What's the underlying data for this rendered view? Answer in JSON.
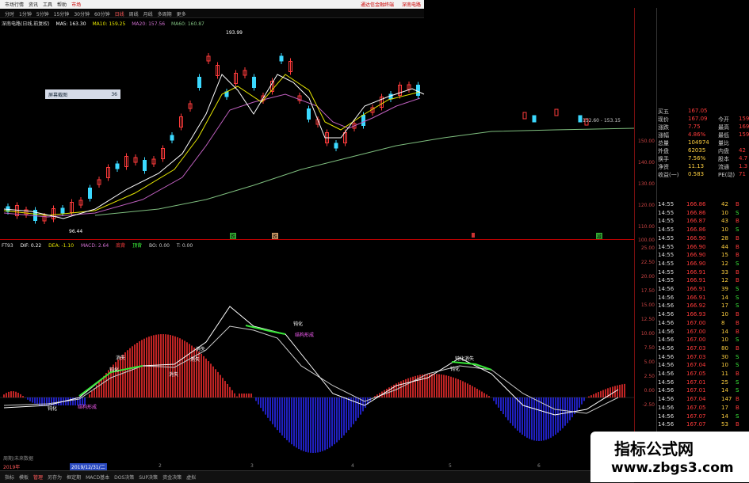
{
  "menubar": {
    "items": [
      "市场行情",
      "资讯",
      "工具",
      "帮助",
      "市场"
    ],
    "right_items": [
      "通达信金融终端",
      "深南电路"
    ]
  },
  "timebar": {
    "items": [
      "分时",
      "1分钟",
      "5分钟",
      "15分钟",
      "30分钟",
      "60分钟",
      "日线",
      "周线",
      "月线",
      "多周期",
      "更多"
    ]
  },
  "title": {
    "stock": "深南电路(日线,前复权)",
    "ma5": "MA5: 163.30",
    "ma10": "MA10: 159.25",
    "ma20": "MA20: 157.56",
    "ma60": "MA60: 160.87"
  },
  "price_chart": {
    "max_label": "193.99",
    "min_label": "96.44",
    "range_label": "152.60 - 153.15",
    "popup": {
      "label": "屏幕截图",
      "value": "36"
    },
    "markers": [
      "跌",
      "跌",
      "跌",
      "减"
    ]
  },
  "indicator": {
    "name": "FT93",
    "dif": "DIF: 0.22",
    "dea": "DEA: -1.10",
    "macd": "MACD: 2.64",
    "t1": "底背",
    "t2": "顶背",
    "bo": "BO: 0.00",
    "t": "T: 0.00",
    "annotations": [
      "消失",
      "钝化",
      "消失",
      "消失",
      "钝化",
      "钝化",
      "结构形成",
      "钝化",
      "钝化消失",
      "消失",
      "结构形成"
    ]
  },
  "yaxis_price": [
    "150.00",
    "140.00",
    "130.00",
    "120.00",
    "110.00",
    "100.00"
  ],
  "yaxis_ind": [
    "25.00",
    "22.50",
    "20.00",
    "17.50",
    "15.00",
    "12.50",
    "10.00",
    "7.50",
    "5.00",
    "2.50",
    "0.00",
    "-2.50"
  ],
  "quote": [
    {
      "label": "买五",
      "value": "167.05",
      "label2": "",
      "value2": ""
    },
    {
      "label": "现价",
      "value": "167.09",
      "label2": "今开",
      "value2": "159"
    },
    {
      "label": "涨跌",
      "value": "7.75",
      "label2": "最高",
      "value2": "169"
    },
    {
      "label": "涨幅",
      "value": "4.86%",
      "label2": "最低",
      "value2": "159"
    },
    {
      "label": "总量",
      "value": "104974",
      "label2": "量比",
      "value2": ""
    },
    {
      "label": "外盘",
      "value": "62035",
      "label2": "内盘",
      "value2": "42"
    },
    {
      "label": "换手",
      "value": "7.56%",
      "label2": "股本",
      "value2": "4.7"
    },
    {
      "label": "净资",
      "value": "11.13",
      "label2": "流通",
      "value2": "1.3"
    },
    {
      "label": "收益(一)",
      "value": "0.583",
      "label2": "PE(动)",
      "value2": "71"
    }
  ],
  "ticks": [
    {
      "t": "14:55",
      "p": "166.86",
      "v": "42",
      "s": "B"
    },
    {
      "t": "14:55",
      "p": "166.86",
      "v": "10",
      "s": "S"
    },
    {
      "t": "14:55",
      "p": "166.87",
      "v": "43",
      "s": "B"
    },
    {
      "t": "14:55",
      "p": "166.86",
      "v": "10",
      "s": "S"
    },
    {
      "t": "14:55",
      "p": "166.90",
      "v": "28",
      "s": "B"
    },
    {
      "t": "14:55",
      "p": "166.90",
      "v": "44",
      "s": "B"
    },
    {
      "t": "14:55",
      "p": "166.90",
      "v": "15",
      "s": "B"
    },
    {
      "t": "14:55",
      "p": "166.90",
      "v": "12",
      "s": "S"
    },
    {
      "t": "14:55",
      "p": "166.91",
      "v": "33",
      "s": "B"
    },
    {
      "t": "14:55",
      "p": "166.91",
      "v": "12",
      "s": "B"
    },
    {
      "t": "14:56",
      "p": "166.91",
      "v": "39",
      "s": "S"
    },
    {
      "t": "14:56",
      "p": "166.91",
      "v": "14",
      "s": "S"
    },
    {
      "t": "14:56",
      "p": "166.92",
      "v": "17",
      "s": "S"
    },
    {
      "t": "14:56",
      "p": "166.93",
      "v": "10",
      "s": "B"
    },
    {
      "t": "14:56",
      "p": "167.00",
      "v": "8",
      "s": "B"
    },
    {
      "t": "14:56",
      "p": "167.00",
      "v": "14",
      "s": "B"
    },
    {
      "t": "14:56",
      "p": "167.00",
      "v": "10",
      "s": "S"
    },
    {
      "t": "14:56",
      "p": "167.03",
      "v": "80",
      "s": "B"
    },
    {
      "t": "14:56",
      "p": "167.03",
      "v": "30",
      "s": "S"
    },
    {
      "t": "14:56",
      "p": "167.04",
      "v": "10",
      "s": "S"
    },
    {
      "t": "14:56",
      "p": "167.05",
      "v": "11",
      "s": "B"
    },
    {
      "t": "14:56",
      "p": "167.01",
      "v": "25",
      "s": "S"
    },
    {
      "t": "14:56",
      "p": "167.01",
      "v": "14",
      "s": "S"
    },
    {
      "t": "14:56",
      "p": "167.04",
      "v": "147",
      "s": "B"
    },
    {
      "t": "14:56",
      "p": "167.05",
      "v": "17",
      "s": "B"
    },
    {
      "t": "14:56",
      "p": "167.07",
      "v": "14",
      "s": "S"
    },
    {
      "t": "14:56",
      "p": "167.07",
      "v": "53",
      "s": "B"
    }
  ],
  "datebar": {
    "left_label": "周期/未来数据",
    "year": "2019年",
    "cursor_date": "2019/12/31/二",
    "months": [
      "2",
      "3",
      "4",
      "5",
      "6"
    ]
  },
  "bottom_tabs": [
    "指标",
    "模板",
    "管理",
    "另存为",
    "框定期",
    "MACD基本",
    "DOS决策",
    "SUP决策",
    "资金决策",
    "虚拟"
  ],
  "watermark": {
    "line1": "指标公式网",
    "line2": "www.zbgs3.com"
  },
  "colors": {
    "up": "#ff3b3b",
    "down": "#3bd9ff",
    "ma5": "#ffffff",
    "ma10": "#e6e600",
    "ma20": "#d070d0",
    "ma60": "#80c080",
    "macd_up": "#ff3030",
    "macd_down": "#2a2aff"
  }
}
